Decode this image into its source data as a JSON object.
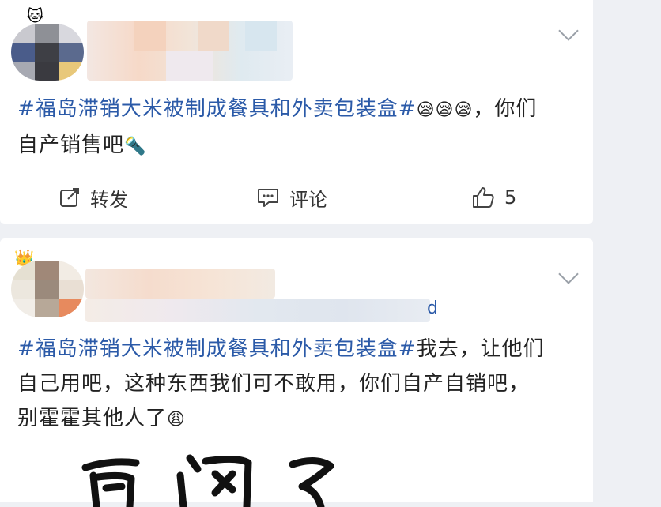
{
  "posts": [
    {
      "hashtag": "#福岛滞销大米被制成餐具和外卖包装盒#",
      "emoji1": "😪😪😪",
      "text_after": "，你们",
      "line2": "自产销售吧",
      "emoji2": "🔦",
      "actions": {
        "repost": "转发",
        "comment": "评论",
        "like_count": "5"
      }
    },
    {
      "hashtag": "#福岛滞销大米被制成餐具和外卖包装盒#",
      "text_after": "我去，让他们",
      "line2": "自己用吧，这种东西我们可不敢用，你们自产自销吧，",
      "line3": "别霍霍其他人了",
      "emoji": "😩",
      "name_tail": "d",
      "image_text": "互 闭 了"
    }
  ],
  "colors": {
    "hashtag": "#2b5aa8",
    "background": "#eef0f4",
    "card": "#ffffff"
  },
  "icons": [
    "expand-chevron-icon",
    "repost-icon",
    "comment-icon",
    "like-icon",
    "vip-crown-icon"
  ]
}
